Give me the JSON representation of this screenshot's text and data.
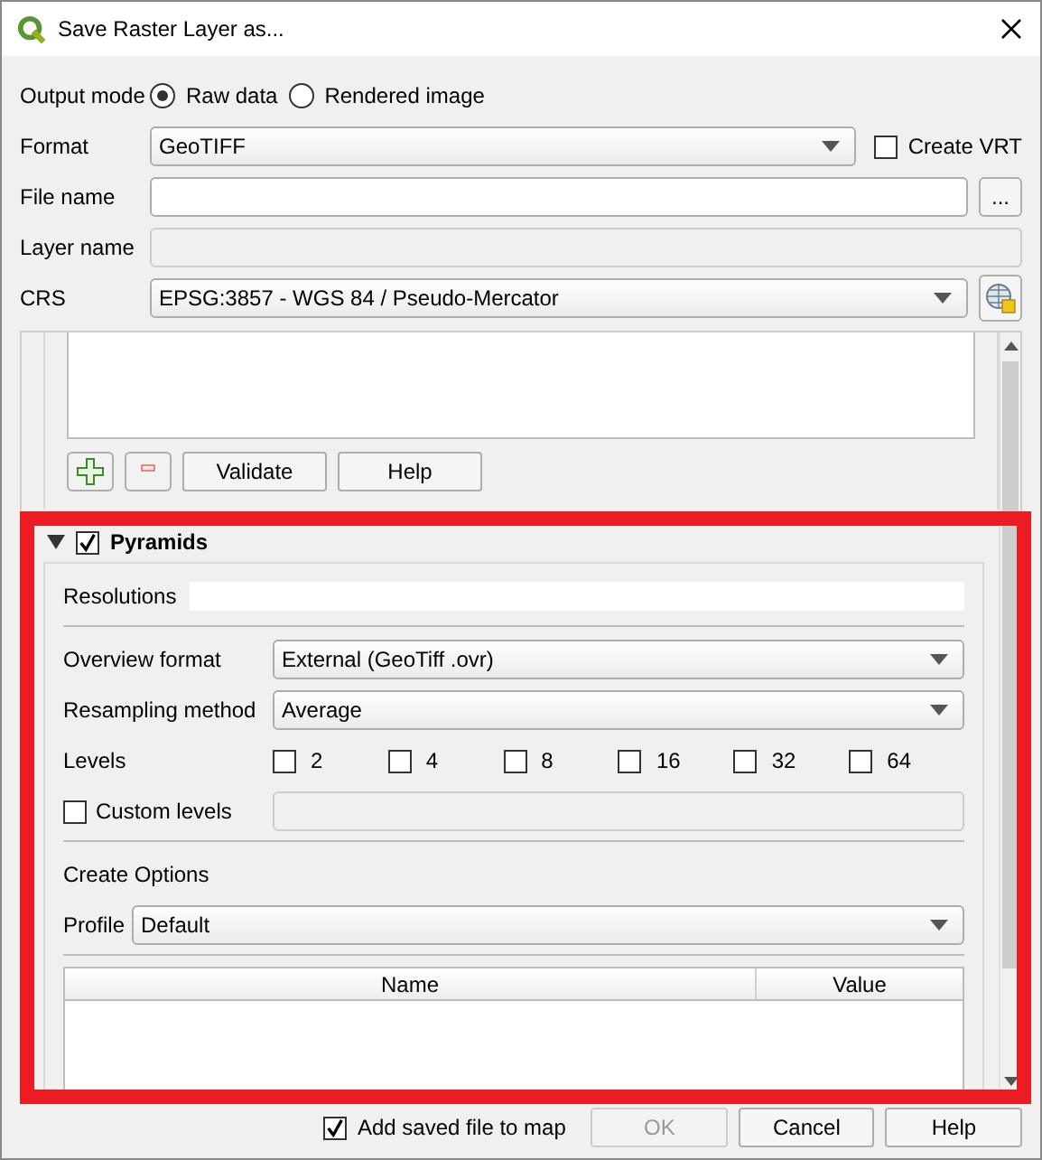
{
  "window": {
    "title": "Save Raster Layer as..."
  },
  "output_mode": {
    "label": "Output mode",
    "options": [
      {
        "label": "Raw data",
        "selected": true
      },
      {
        "label": "Rendered image",
        "selected": false
      }
    ]
  },
  "format": {
    "label": "Format",
    "value": "GeoTIFF",
    "create_vrt": {
      "label": "Create VRT",
      "checked": false
    }
  },
  "file_name": {
    "label": "File name",
    "browse": "..."
  },
  "layer_name": {
    "label": "Layer name",
    "disabled": true
  },
  "crs": {
    "label": "CRS",
    "value": "EPSG:3857 - WGS 84 / Pseudo-Mercator"
  },
  "options_panel": {
    "buttons": [
      "Validate",
      "Help"
    ]
  },
  "pyramids": {
    "title": "Pyramids",
    "checked": true,
    "expanded": true,
    "resolutions_label": "Resolutions",
    "overview_format": {
      "label": "Overview format",
      "value": "External (GeoTiff .ovr)"
    },
    "resampling": {
      "label": "Resampling method",
      "value": "Average"
    },
    "levels": {
      "label": "Levels",
      "items": [
        {
          "label": "2",
          "checked": false
        },
        {
          "label": "4",
          "checked": false
        },
        {
          "label": "8",
          "checked": false
        },
        {
          "label": "16",
          "checked": false
        },
        {
          "label": "32",
          "checked": false
        },
        {
          "label": "64",
          "checked": false
        }
      ]
    },
    "custom_levels": {
      "label": "Custom levels",
      "checked": false
    },
    "create_options": {
      "title": "Create Options",
      "profile_label": "Profile",
      "profile_value": "Default",
      "columns": [
        "Name",
        "Value"
      ]
    }
  },
  "footer": {
    "add_to_map": {
      "label": "Add saved file to map",
      "checked": true
    },
    "buttons": [
      {
        "label": "OK",
        "disabled": true
      },
      {
        "label": "Cancel",
        "disabled": false
      },
      {
        "label": "Help",
        "disabled": false
      }
    ]
  }
}
